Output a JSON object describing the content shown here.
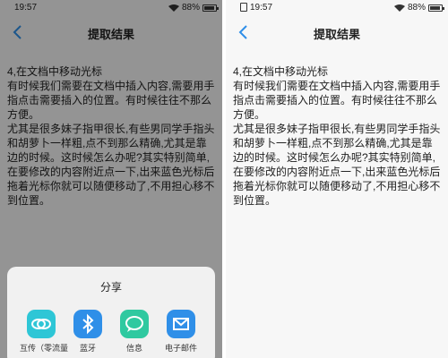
{
  "status": {
    "time": "19:57",
    "battery": "88%"
  },
  "nav": {
    "title": "提取结果"
  },
  "content": {
    "lines": [
      "4,在文档中移动光标",
      "有时候我们需要在文档中插入内容,需要用手指点击需要插入的位置。有时候往往不那么方便。",
      "尤其是很多妹子指甲很长,有些男同学手指头和胡萝卜一样粗,点不到那么精确,尤其是靠边的时候。这时候怎么办呢?其实特别简单,在要修改的内容附近点一下,出来蓝色光标后拖着光标你就可以随便移动了,不用担心移不到位置。"
    ]
  },
  "share_sheet": {
    "title": "分享",
    "items": [
      {
        "label": "互传（零流量",
        "icon": "swap-transfer-icon",
        "color": "#2ec6d6"
      },
      {
        "label": "蓝牙",
        "icon": "bluetooth-icon",
        "color": "#2f8fe8"
      },
      {
        "label": "信息",
        "icon": "message-icon",
        "color": "#2fc9a0"
      },
      {
        "label": "电子邮件",
        "icon": "mail-icon",
        "color": "#2f8fe8"
      }
    ]
  },
  "colors": {
    "accent": "#2f8fe8",
    "overlay": "rgba(0,0,0,0.4)"
  }
}
